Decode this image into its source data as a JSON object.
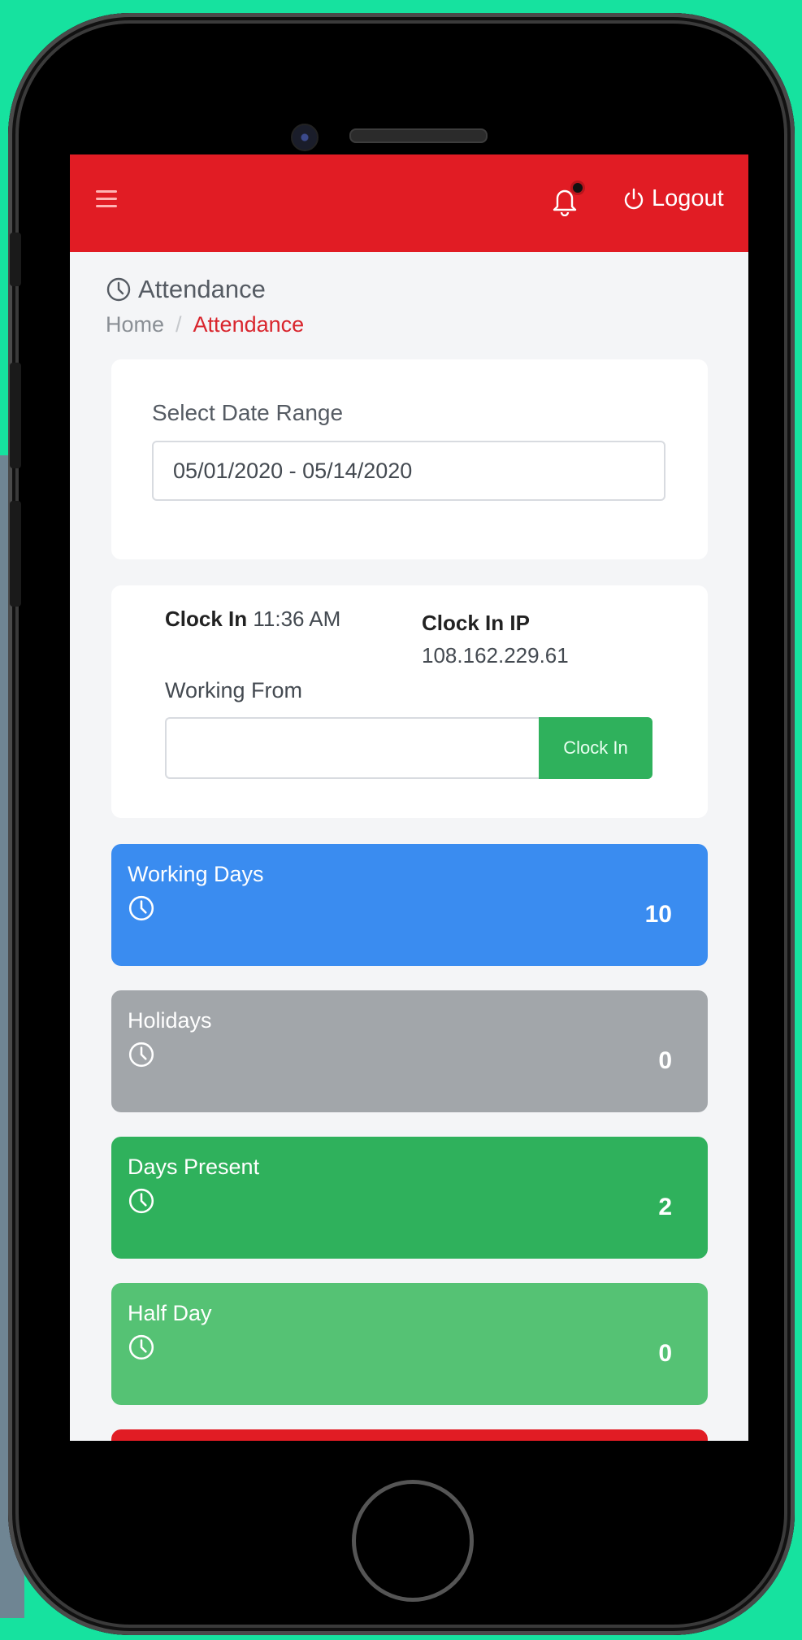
{
  "header": {
    "logout_label": "Logout"
  },
  "page": {
    "title": "Attendance",
    "breadcrumb": {
      "home": "Home",
      "separator": "/",
      "current": "Attendance"
    }
  },
  "date_range": {
    "label": "Select Date Range",
    "value": "05/01/2020 - 05/14/2020"
  },
  "clock": {
    "clock_in_label": "Clock In",
    "clock_in_time": "11:36 AM",
    "ip_label": "Clock In IP",
    "ip_value": "108.162.229.61",
    "working_from_label": "Working From",
    "working_from_value": "",
    "button_label": "Clock In"
  },
  "stats": [
    {
      "label": "Working Days",
      "value": "10",
      "color": "#3a8cf0"
    },
    {
      "label": "Holidays",
      "value": "0",
      "color": "#a2a6aa"
    },
    {
      "label": "Days Present",
      "value": "2",
      "color": "#2fb15c"
    },
    {
      "label": "Half Day",
      "value": "0",
      "color": "#55c274"
    }
  ],
  "colors": {
    "brand_red": "#e11c24",
    "accent_red": "#d9252d",
    "success_green": "#2fb15c"
  },
  "icons": [
    "menu-icon",
    "bell-icon",
    "power-icon",
    "clock-icon"
  ]
}
